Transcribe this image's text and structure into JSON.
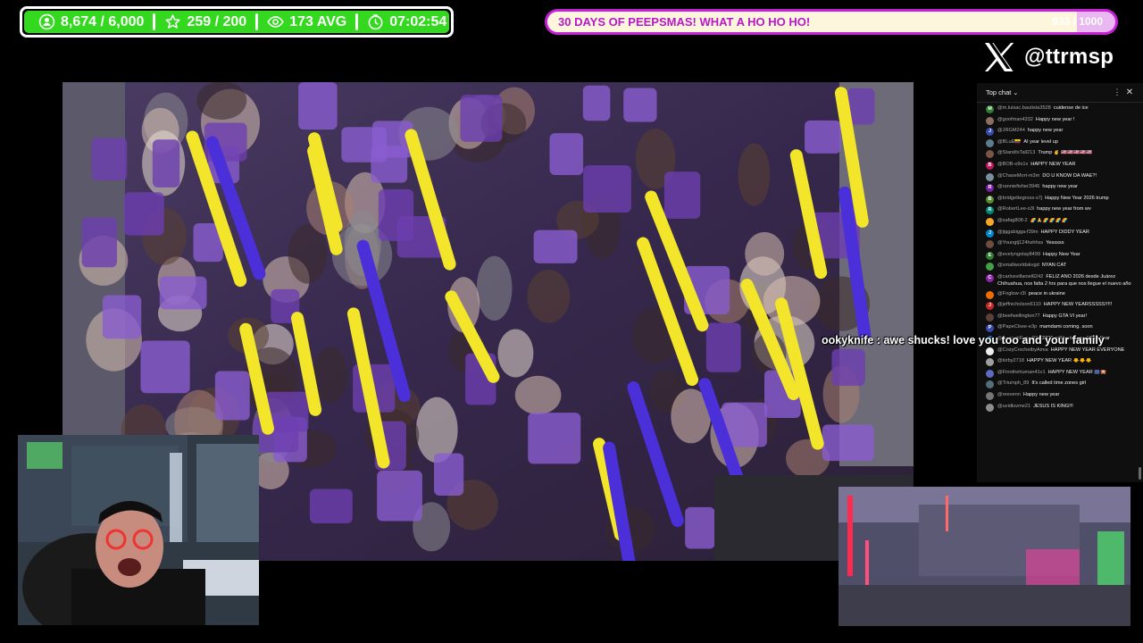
{
  "stats": {
    "items": [
      {
        "icon": "person-badge-icon",
        "value": "8,674 / 6,000"
      },
      {
        "icon": "star-icon",
        "value": "259 / 200"
      },
      {
        "icon": "eye-icon",
        "value": "173 AVG"
      },
      {
        "icon": "timer-icon",
        "value": "07:02:54"
      }
    ],
    "bar_color": "#33d81f"
  },
  "goal": {
    "title": "30 DAYS OF PEEPSMAS! WHAT A HO HO HO!",
    "count": "933 / 1000",
    "progress": 0.933,
    "accent": "#c51fd8"
  },
  "social": {
    "icon": "x-logo-icon",
    "handle": "@ttrmsp"
  },
  "chat": {
    "title": "Top chat",
    "messages": [
      {
        "avatar": "M",
        "color": "#2e7d32",
        "author": "@m.luisac.bautista3528",
        "text": "cuidense de ice"
      },
      {
        "avatar": "",
        "color": "#8d6e63",
        "author": "@goofman4332",
        "text": "Happy new year !"
      },
      {
        "avatar": "J",
        "color": "#3949ab",
        "author": "@JRGM244",
        "text": "happy new year"
      },
      {
        "avatar": "",
        "color": "#607d8b",
        "author": "@BLuE🇪🇨",
        "text": "AI year level up"
      },
      {
        "avatar": "",
        "color": "#795548",
        "author": "@StandIsTall213",
        "text": "Trump ✌ 🇺🇸🇺🇸🇺🇸🇺🇸🇺🇸"
      },
      {
        "avatar": "B",
        "color": "#c2185b",
        "author": "@BOB-o9x1x",
        "text": "HAPPY NEW YEAR"
      },
      {
        "avatar": "",
        "color": "#78909c",
        "author": "@ChaseMort-m3m",
        "text": "DO U KNOW DA WAE?!"
      },
      {
        "avatar": "R",
        "color": "#7b1fa2",
        "author": "@ranniefisher3946",
        "text": "happy new year"
      },
      {
        "avatar": "B",
        "color": "#558b2f",
        "author": "@bridgettegross-s7j",
        "text": "Happy New Year 2026 trump"
      },
      {
        "avatar": "R",
        "color": "#00897b",
        "author": "@RobertLee-o3l",
        "text": "happy new year from wv"
      },
      {
        "avatar": "",
        "color": "#f9a825",
        "author": "@safag808-2",
        "text": "🌈🙏🌈🌈🌈🌈"
      },
      {
        "avatar": "J",
        "color": "#0288d1",
        "author": "@jiggabigga-f39m",
        "text": "HAPPY DIDDY YEAR"
      },
      {
        "avatar": "",
        "color": "#6d4c41",
        "author": "@Youngtj124hshhss",
        "text": "Yesssss"
      },
      {
        "avatar": "E",
        "color": "#2e7d32",
        "author": "@evelyngotay8499",
        "text": "Happy New Year"
      },
      {
        "avatar": "",
        "color": "#43a047",
        "author": "@smallworldskvgd",
        "text": "NYAN CAT"
      },
      {
        "avatar": "C",
        "color": "#8e24aa",
        "author": "@carlosvillaniel6242",
        "text": "FELIZ AÑO 2026 desde Juárez Chihuahua, nos falta 2 hrs para que nos llegue el nuevo año"
      },
      {
        "avatar": "",
        "color": "#ef6c00",
        "author": "@Foglow-r3l",
        "text": "peace in ukraine"
      },
      {
        "avatar": "J",
        "color": "#c62828",
        "author": "@jeffnicholson6110",
        "text": "HAPPY NEW YEARSSSSS!!!!!"
      },
      {
        "avatar": "",
        "color": "#5d4037",
        "author": "@beefwellington77",
        "text": "Happy GTA VI year!"
      },
      {
        "avatar": "P",
        "color": "#3949ab",
        "author": "@PapeClsee-e3p",
        "text": "mamdami coming. soon"
      },
      {
        "avatar": "",
        "color": "#1e88e5",
        "author": "@AzariahRyan789",
        "text": "2026 will be its own NEW Year"
      },
      {
        "avatar": "",
        "color": "#eeeeee",
        "author": "@CozyCrochetbyAima",
        "text": "HAPPY NEW YEAR EVERYONE"
      },
      {
        "avatar": "",
        "color": "#9e9e9e",
        "author": "@kirby2718",
        "text": "HAPPY NEW YEAR 🐥🐥🐥"
      },
      {
        "avatar": "",
        "color": "#5c6bc0",
        "author": "@Finnthehuman41v1",
        "text": "HAPPY NEW YEAR 🎆🎇"
      },
      {
        "avatar": "",
        "color": "#546e7a",
        "author": "@Triumph_89",
        "text": "It's called time zones girl"
      },
      {
        "avatar": "",
        "color": "#757575",
        "author": "@reevenn",
        "text": "Happy new year"
      },
      {
        "avatar": "",
        "color": "#8d8d8d",
        "author": "@uvidluvme21",
        "text": "JESUS IS KING!!!"
      }
    ]
  },
  "overlay_chat": {
    "name": "ookyknife",
    "separator": " : ",
    "text": "awe shucks! love you too and your family"
  }
}
